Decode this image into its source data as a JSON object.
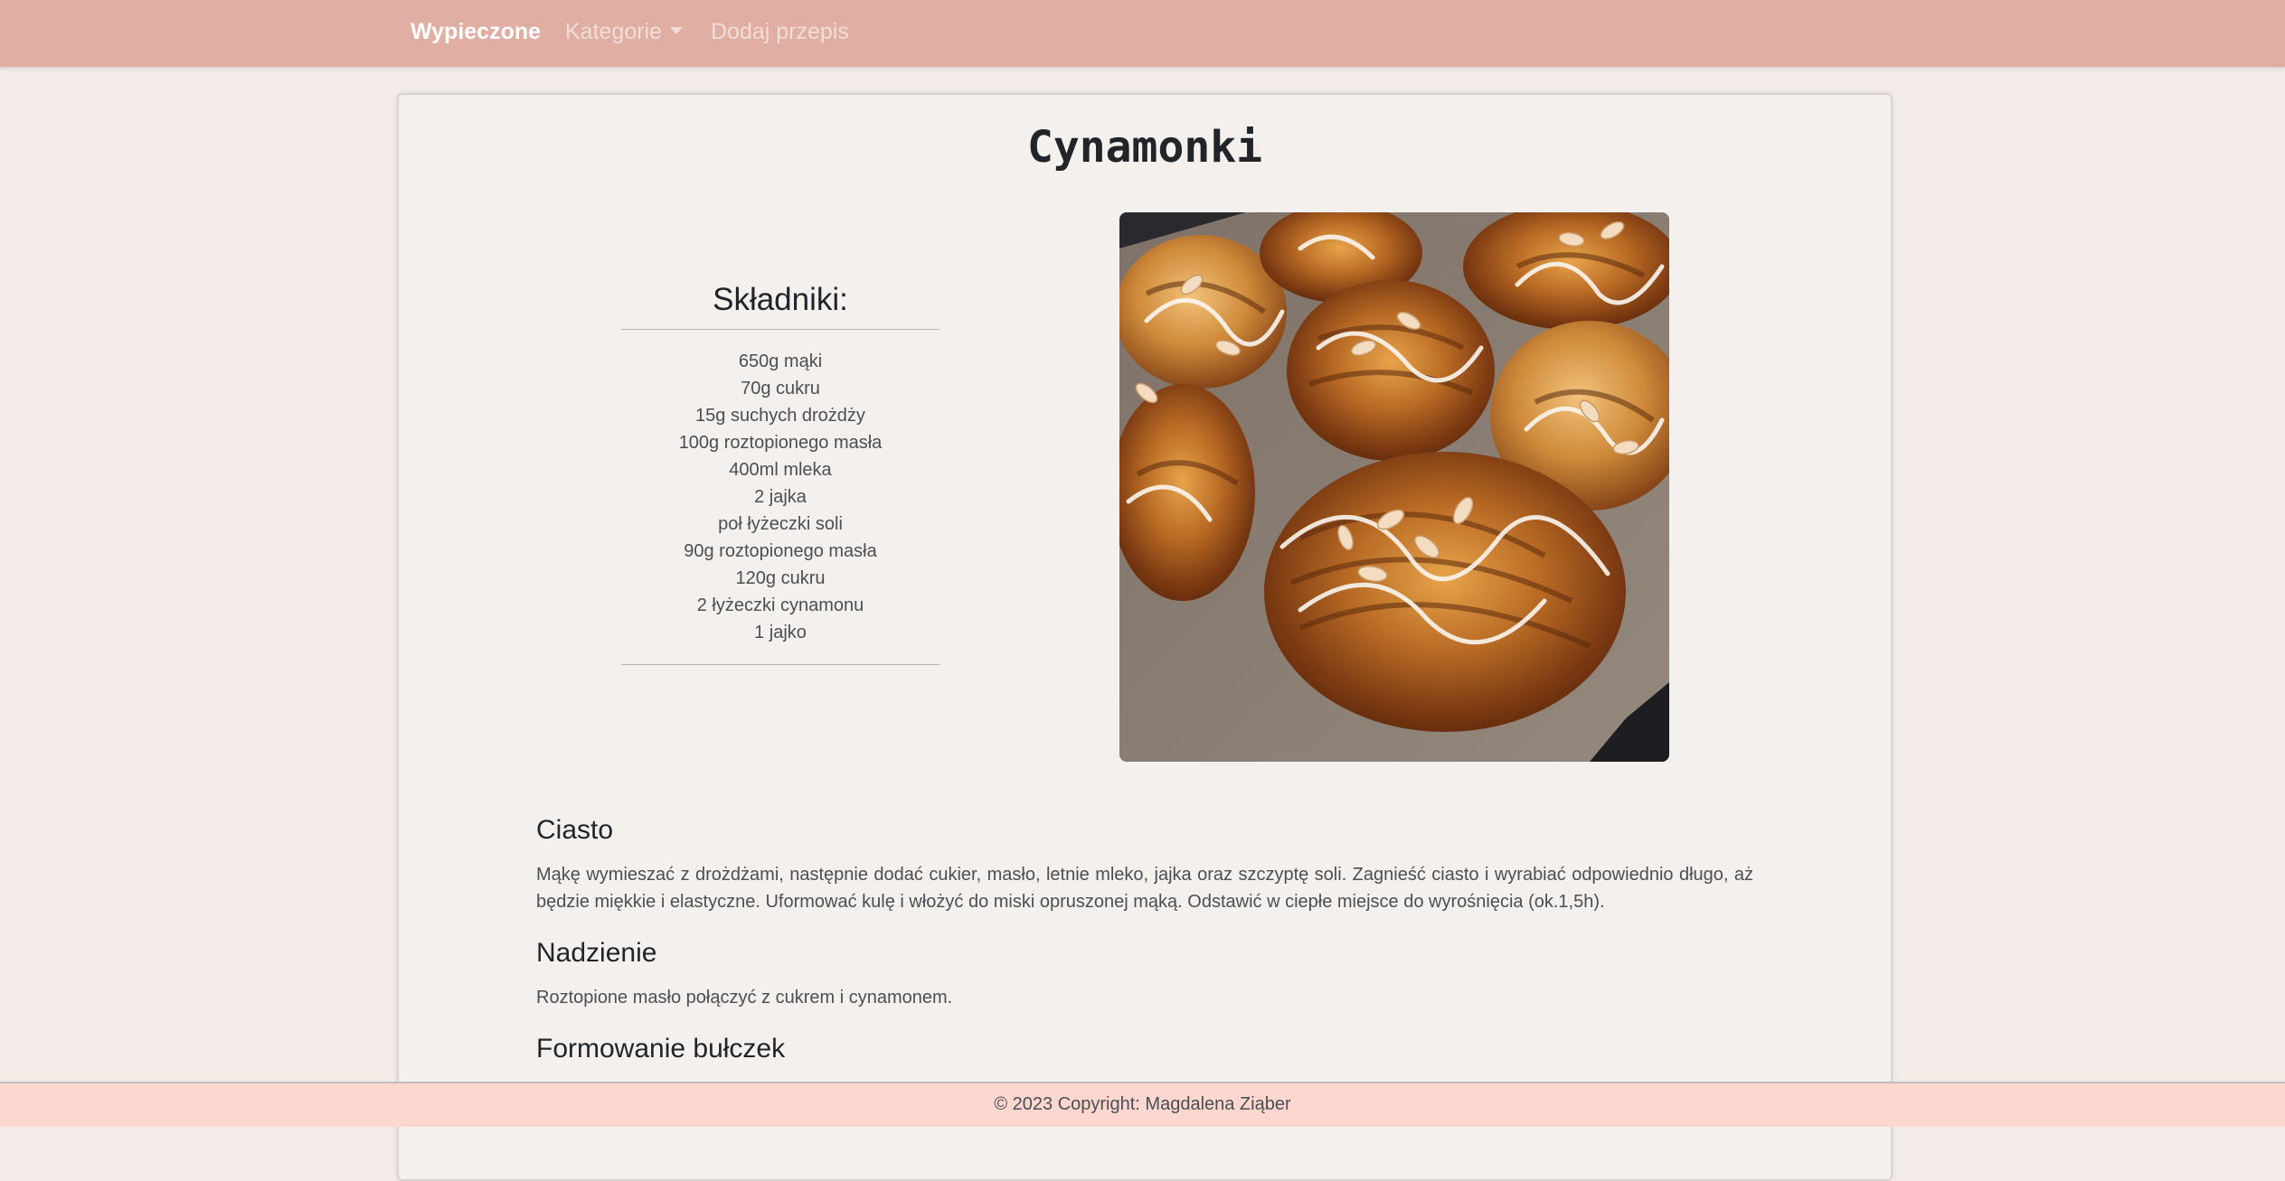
{
  "navbar": {
    "brand": "Wypieczone",
    "categories_label": "Kategorie",
    "add_recipe_label": "Dodaj przepis"
  },
  "recipe": {
    "title": "Cynamonki",
    "ingredients_heading": "Składniki:",
    "ingredients": [
      "650g mąki",
      "70g cukru",
      "15g suchych drożdży",
      "100g roztopionego masła",
      "400ml mleka",
      "2 jajka",
      "poł łyżeczki soli",
      "90g roztopionego masła",
      "120g cukru",
      "2 łyżeczki cynamonu",
      "1 jajko"
    ],
    "steps": [
      {
        "heading": "Ciasto",
        "text": "Mąkę wymieszać z drożdżami, następnie dodać cukier, masło, letnie mleko, jajka oraz szczyptę soli. Zagnieść ciasto i wyrabiać odpowiednio długo, aż będzie miękkie i elastyczne. Uformować kulę i włożyć do miski opruszonej mąką. Odstawić w ciepłe miejsce do wyrośnięcia (ok.1,5h)."
      },
      {
        "heading": "Nadzienie",
        "text": "Roztopione masło połączyć z cukrem i cynamonem."
      },
      {
        "heading": "Formowanie bułczek",
        "text": ""
      }
    ]
  },
  "footer": {
    "copyright": "© 2023 Copyright: Magdalena Ziąber"
  },
  "colors": {
    "navbar": "#e0aea2",
    "page_background": "#f2ebe7",
    "card_background": "#f3f0ed",
    "footer": "#fcd7d0"
  },
  "icons": {
    "categories_dropdown": "caret-down-icon"
  }
}
